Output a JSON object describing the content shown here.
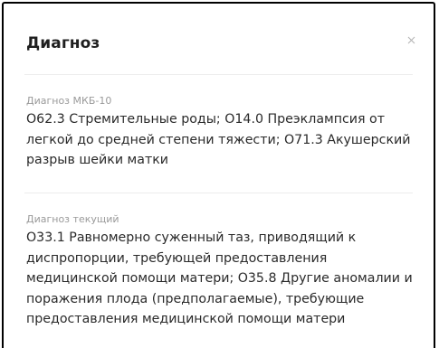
{
  "dialog": {
    "title": "Диагноз",
    "close_icon": "close-icon"
  },
  "sections": [
    {
      "label": "Диагноз МКБ-10",
      "text": "O62.3 Стремительные роды; O14.0 Преэклампсия от легкой до средней степени тяжести; O71.3 Акушерский разрыв шейки матки"
    },
    {
      "label": "Диагноз текущий",
      "text": "O33.1 Равномерно суженный таз, приводящий к диспропорции, требующей предоставления медицинской помощи матери; O35.8 Другие аномалии и поражения плода (предполагаемые), требующие предоставления медицинской помощи матери"
    }
  ]
}
